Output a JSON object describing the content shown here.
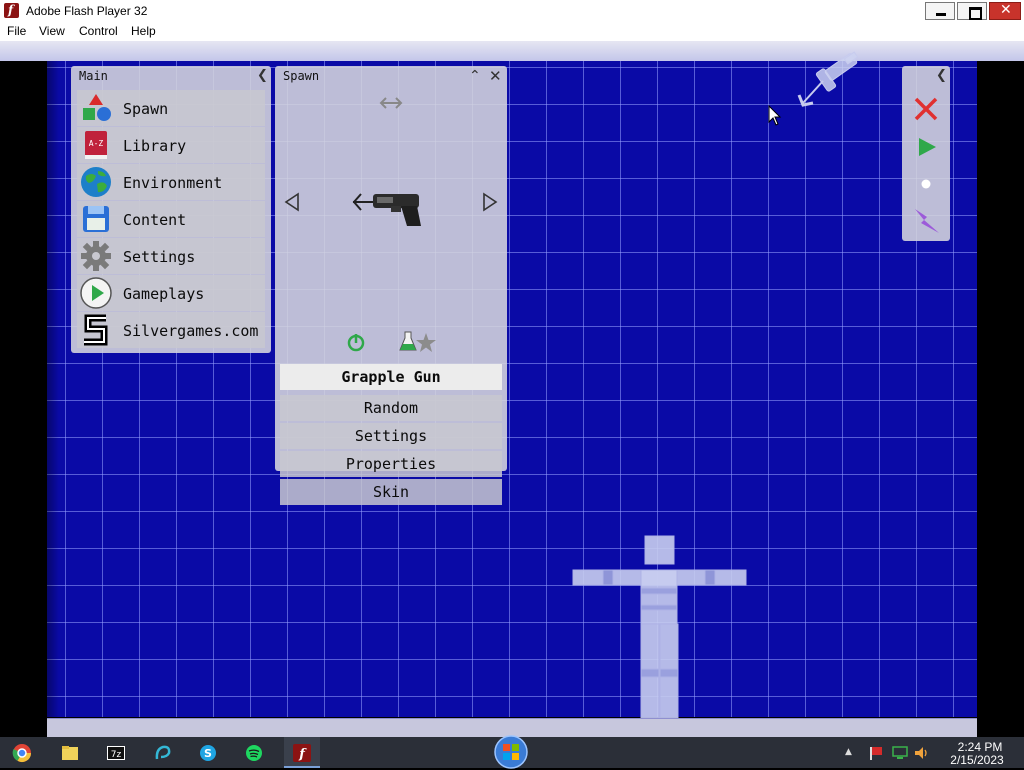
{
  "window": {
    "title": "Adobe Flash Player 32"
  },
  "menu": [
    "File",
    "View",
    "Control",
    "Help"
  ],
  "main_panel": {
    "title": "Main",
    "items": [
      {
        "label": "Spawn",
        "icon": "shapes-icon"
      },
      {
        "label": "Library",
        "icon": "book-icon"
      },
      {
        "label": "Environment",
        "icon": "globe-icon"
      },
      {
        "label": "Content",
        "icon": "floppy-disk-icon"
      },
      {
        "label": "Settings",
        "icon": "gear-icon"
      },
      {
        "label": "Gameplays",
        "icon": "play-icon"
      },
      {
        "label": "Silvergames.com",
        "icon": "silvergames-logo-icon"
      }
    ]
  },
  "spawn_panel": {
    "title": "Spawn",
    "selected_item": "Grapple Gun",
    "items": [
      "Random",
      "Settings",
      "Properties",
      "Skin"
    ]
  },
  "tool_panel": {
    "tools": [
      "close-icon",
      "play-icon",
      "dot-icon",
      "lightning-icon"
    ]
  },
  "taskbar": {
    "apps": [
      "chrome-icon",
      "folder-icon",
      "7zip-icon",
      "app-icon",
      "skype-icon",
      "spotify-icon",
      "flash-icon"
    ],
    "time": "2:24 PM",
    "date": "2/15/2023"
  },
  "colors": {
    "grid_background": "#0a0aa6",
    "panel": "#d6d6de",
    "taskbar": "#2b2f38"
  }
}
